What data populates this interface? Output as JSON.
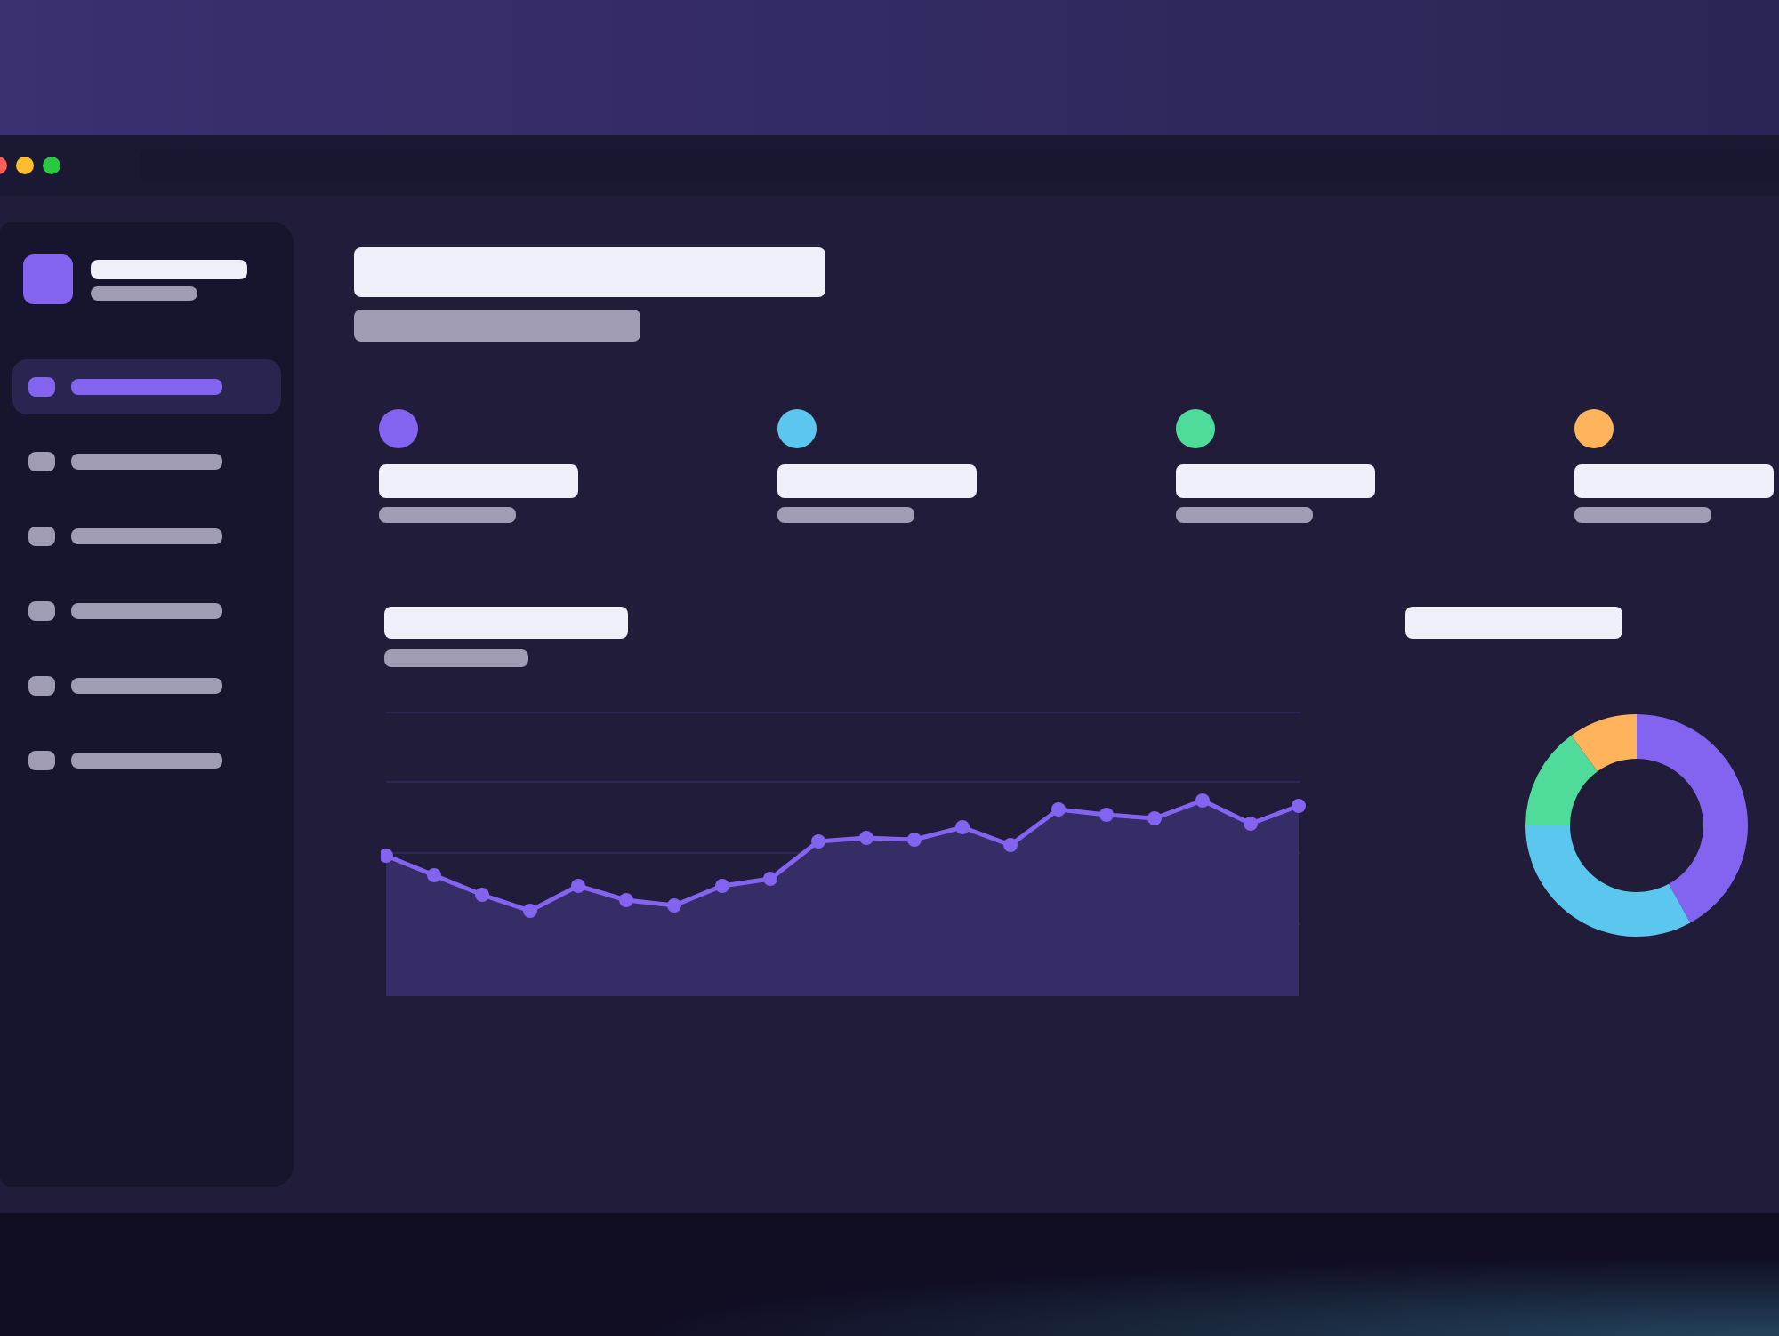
{
  "sidebar": {
    "items": [
      {
        "selected": true
      },
      {
        "selected": false
      },
      {
        "selected": false
      },
      {
        "selected": false
      },
      {
        "selected": false
      },
      {
        "selected": false
      }
    ]
  },
  "stats": [
    {
      "color": "#8364f0"
    },
    {
      "color": "#5bc6ee"
    },
    {
      "color": "#4fdc9b"
    },
    {
      "color": "#ffb45c"
    }
  ]
}
